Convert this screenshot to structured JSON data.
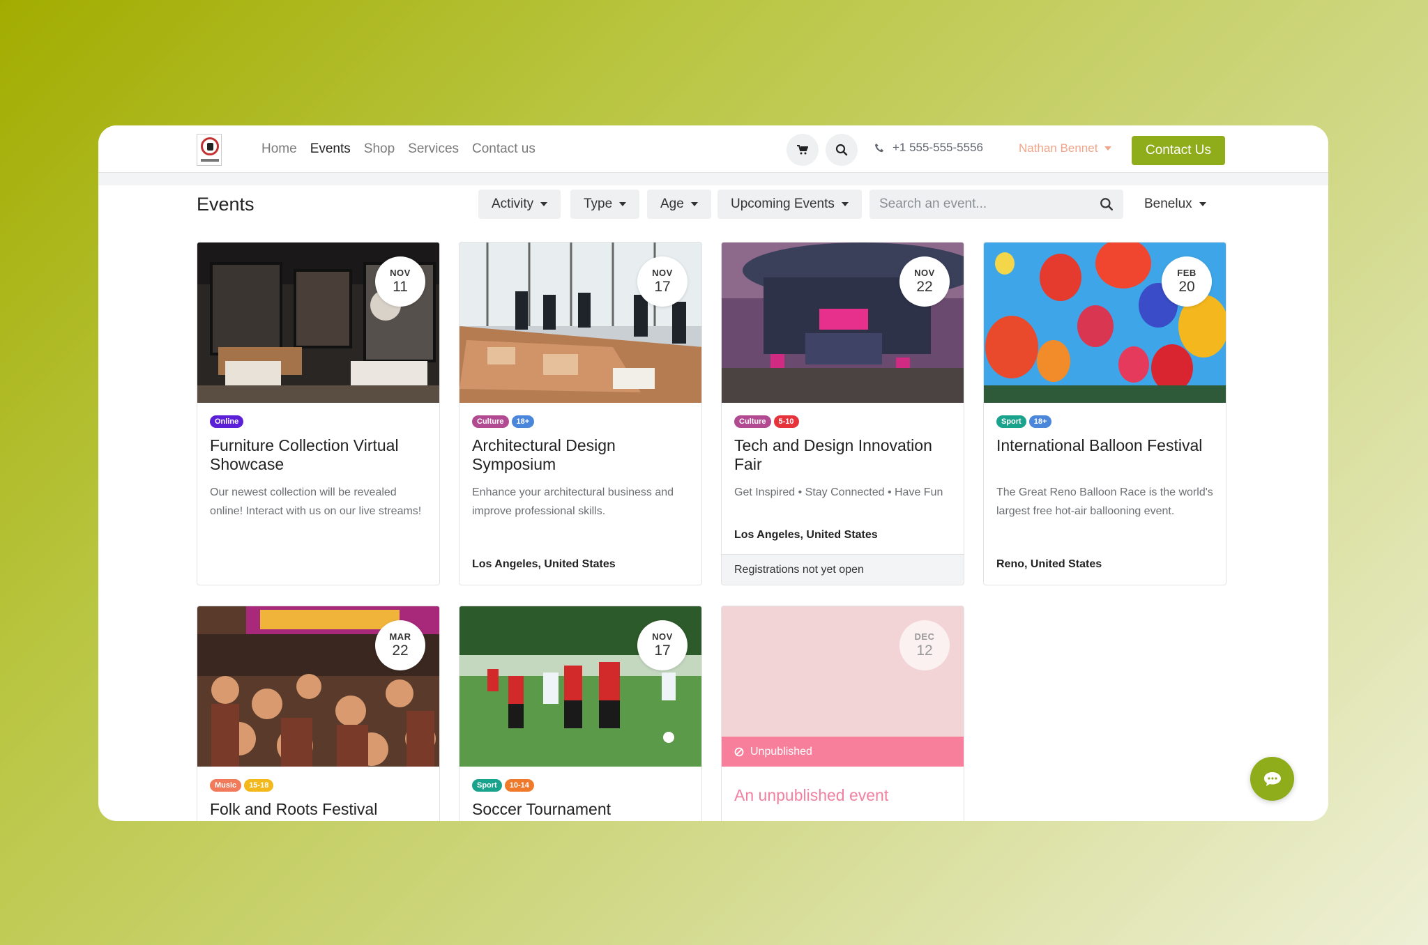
{
  "nav": {
    "links": [
      "Home",
      "Events",
      "Shop",
      "Services",
      "Contact us"
    ],
    "phone": "+1 555-555-5556",
    "user": "Nathan Bennet",
    "contact_button": "Contact Us"
  },
  "page": {
    "title": "Events",
    "filters": [
      "Activity",
      "Type",
      "Age",
      "Upcoming Events"
    ],
    "search_placeholder": "Search an event...",
    "region": "Benelux"
  },
  "events": [
    {
      "month": "NOV",
      "day": "11",
      "badges": [
        {
          "label": "Online",
          "color": "#5a1fd6"
        }
      ],
      "title": "Furniture Collection Virtual Showcase",
      "description": "Our newest collection will be revealed online! Interact with us on our live streams!",
      "location": ""
    },
    {
      "month": "NOV",
      "day": "17",
      "badges": [
        {
          "label": "Culture",
          "color": "#b24a91"
        },
        {
          "label": "18+",
          "color": "#4a86d9"
        }
      ],
      "title": "Architectural Design Symposium",
      "description": "Enhance your architectural business and improve professional skills.",
      "location": "Los Angeles, United States"
    },
    {
      "month": "NOV",
      "day": "22",
      "badges": [
        {
          "label": "Culture",
          "color": "#b24a91"
        },
        {
          "label": "5-10",
          "color": "#e5323b"
        }
      ],
      "title": "Tech and Design Innovation Fair",
      "description": "Get Inspired • Stay Connected • Have Fun",
      "location": "Los Angeles, United States",
      "footer": "Registrations not yet open"
    },
    {
      "month": "FEB",
      "day": "20",
      "badges": [
        {
          "label": "Sport",
          "color": "#19a38c"
        },
        {
          "label": "18+",
          "color": "#4a86d9"
        }
      ],
      "title": "International Balloon Festival",
      "description": "The Great Reno Balloon Race is the world's largest free hot-air ballooning event.",
      "location": "Reno, United States"
    },
    {
      "month": "MAR",
      "day": "22",
      "badges": [
        {
          "label": "Music",
          "color": "#f07a5a"
        },
        {
          "label": "15-18",
          "color": "#f2b81c"
        }
      ],
      "title": "Folk and Roots Festival"
    },
    {
      "month": "NOV",
      "day": "17",
      "badges": [
        {
          "label": "Sport",
          "color": "#19a38c"
        },
        {
          "label": "10-14",
          "color": "#f07a2c"
        }
      ],
      "title": "Soccer Tournament"
    },
    {
      "month": "DEC",
      "day": "12",
      "status": "Unpublished",
      "title": "An unpublished event"
    }
  ],
  "colors": {
    "accent": "#8fac1a",
    "unpublished": "#f77f9b"
  },
  "icons": [
    "cart-icon",
    "search-icon",
    "phone-icon",
    "chat-icon",
    "ban-icon"
  ]
}
